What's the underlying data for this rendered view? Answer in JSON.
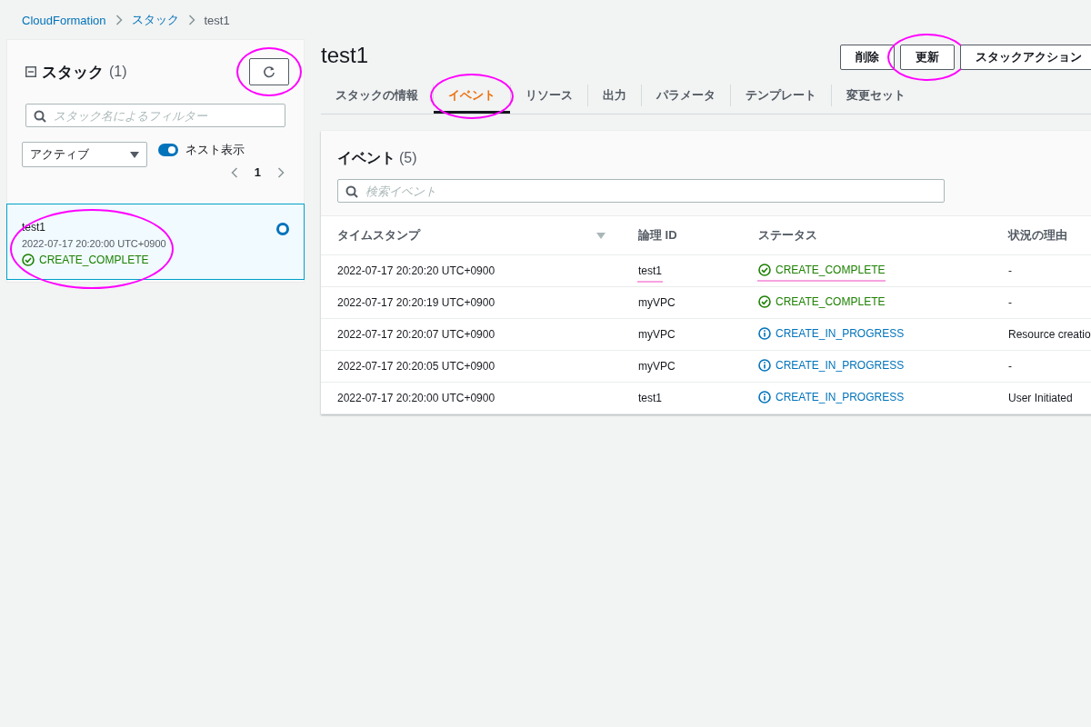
{
  "breadcrumb": [
    {
      "label": "CloudFormation",
      "link": true
    },
    {
      "label": "スタック",
      "link": true
    },
    {
      "label": "test1",
      "link": false
    }
  ],
  "stacks_panel": {
    "title": "スタック",
    "count": "(1)",
    "expanded": true,
    "refresh_circled": true,
    "filter_placeholder": "スタック名によるフィルター",
    "status_filter": "アクティブ",
    "nested_toggle": {
      "label": "ネスト表示",
      "on": true
    },
    "page": "1",
    "items": [
      {
        "name": "test1",
        "time": "2022-07-17 20:20:00 UTC+0900",
        "status": {
          "text": "CREATE_COMPLETE",
          "kind": "complete"
        },
        "selected": true,
        "circled": true
      }
    ]
  },
  "stack": {
    "title": "test1",
    "buttons": [
      {
        "label": "削除",
        "circled": false
      },
      {
        "label": "更新",
        "circled": true
      },
      {
        "label": "スタックアクション",
        "circled": false
      }
    ],
    "tabs": [
      {
        "label": "スタックの情報",
        "selected": false,
        "circled": false
      },
      {
        "label": "イベント",
        "selected": true,
        "circled": true
      },
      {
        "label": "リソース",
        "selected": false,
        "circled": false
      },
      {
        "label": "出力",
        "selected": false,
        "circled": false
      },
      {
        "label": "パラメータ",
        "selected": false,
        "circled": false
      },
      {
        "label": "テンプレート",
        "selected": false,
        "circled": false
      },
      {
        "label": "変更セット",
        "selected": false,
        "circled": false
      }
    ]
  },
  "events": {
    "title": "イベント",
    "count": "(5)",
    "search_placeholder": "検索イベント",
    "columns": [
      {
        "label": "タイムスタンプ",
        "sorted": true
      },
      {
        "label": "論理 ID",
        "sorted": false
      },
      {
        "label": "ステータス",
        "sorted": false
      },
      {
        "label": "状況の理由",
        "sorted": false
      }
    ],
    "rows": [
      {
        "timestamp": "2022-07-17 20:20:20 UTC+0900",
        "logical_id": "test1",
        "id_underlined": true,
        "status": {
          "text": "CREATE_COMPLETE",
          "kind": "complete"
        },
        "status_underlined": true,
        "reason": "-"
      },
      {
        "timestamp": "2022-07-17 20:20:19 UTC+0900",
        "logical_id": "myVPC",
        "id_underlined": false,
        "status": {
          "text": "CREATE_COMPLETE",
          "kind": "complete"
        },
        "status_underlined": false,
        "reason": "-"
      },
      {
        "timestamp": "2022-07-17 20:20:07 UTC+0900",
        "logical_id": "myVPC",
        "id_underlined": false,
        "status": {
          "text": "CREATE_IN_PROGRESS",
          "kind": "progress"
        },
        "status_underlined": false,
        "reason": "Resource creatio"
      },
      {
        "timestamp": "2022-07-17 20:20:05 UTC+0900",
        "logical_id": "myVPC",
        "id_underlined": false,
        "status": {
          "text": "CREATE_IN_PROGRESS",
          "kind": "progress"
        },
        "status_underlined": false,
        "reason": "-"
      },
      {
        "timestamp": "2022-07-17 20:20:00 UTC+0900",
        "logical_id": "test1",
        "id_underlined": false,
        "status": {
          "text": "CREATE_IN_PROGRESS",
          "kind": "progress"
        },
        "status_underlined": false,
        "reason": "User Initiated"
      }
    ]
  }
}
